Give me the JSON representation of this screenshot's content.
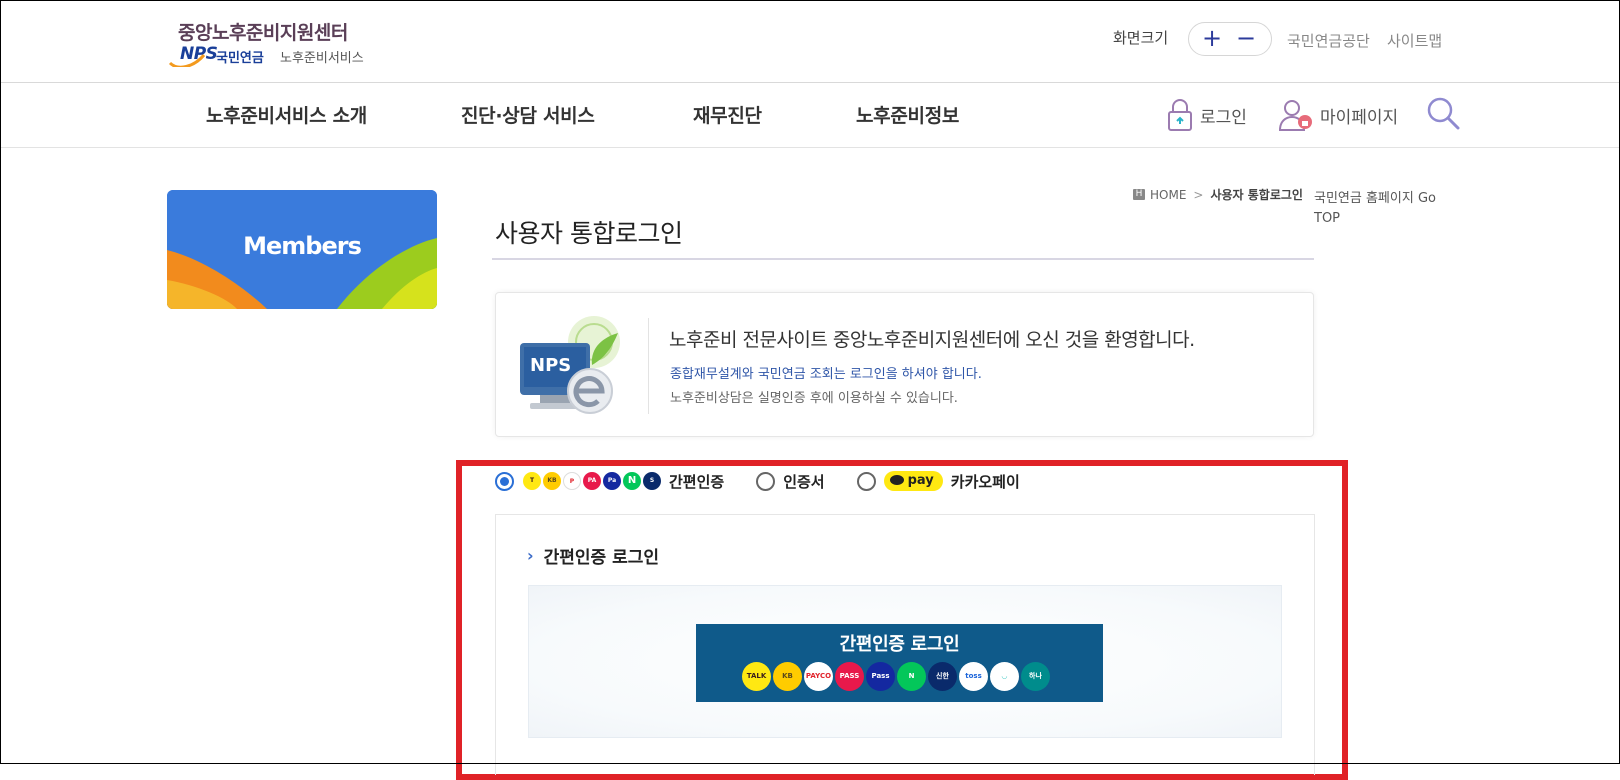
{
  "header": {
    "logo_main": "중앙노후준비지원센터",
    "logo_nps": "NPS",
    "logo_sub1": "국민연금",
    "logo_sub2": "노후준비서비스",
    "fontsize_label": "화면크기",
    "fontsize_plus": "+",
    "fontsize_minus": "−",
    "link_nps": "국민연금공단",
    "link_sitemap": "사이트맵"
  },
  "nav": {
    "items": [
      "노후준비서비스 소개",
      "진단·상담 서비스",
      "재무진단",
      "노후준비정보"
    ],
    "login": "로그인",
    "mypage": "마이페이지"
  },
  "sidebar": {
    "banner_label": "Members"
  },
  "breadcrumb": {
    "home_icon": "H",
    "home": "HOME",
    "sep": ">",
    "current": "사용자 통합로그인"
  },
  "side_links": {
    "nps_home": "국민연금 홈페이지 Go",
    "top": "TOP"
  },
  "page": {
    "title": "사용자 통합로그인"
  },
  "welcome": {
    "badge": "NPS",
    "heading": "노후준비 전문사이트 중앙노후준비지원센터에 오신 것을 환영합니다.",
    "line1": "종합재무설계와 국민연금 조회는 로그인을 하셔야 합니다.",
    "line2": "노후준비상담은 실명인증 후에 이용하실 수 있습니다."
  },
  "login_options": {
    "simple_auth": "간편인증",
    "certificate": "인증서",
    "kakaopay": "카카오페이",
    "pay_badge": "pay",
    "mini_icons": [
      "kakao-icon",
      "kb-icon",
      "payco-icon",
      "pass-icon",
      "samsung-pass-icon",
      "naver-icon",
      "shinhan-icon"
    ],
    "selected": "간편인증"
  },
  "panel": {
    "heading": "간편인증 로그인",
    "button_label": "간편인증 로그인",
    "providers": [
      {
        "name": "kakaotalk-icon",
        "label": "TALK",
        "color": "#ffe812",
        "text": "#3a1d1d"
      },
      {
        "name": "kb-icon",
        "label": "KB",
        "color": "#ffcc00",
        "text": "#5b4a1a"
      },
      {
        "name": "payco-icon",
        "label": "PAYCO",
        "color": "#ffffff",
        "text": "#e1242c"
      },
      {
        "name": "pass-icon",
        "label": "PASS",
        "color": "#e8194b",
        "text": "#ffffff"
      },
      {
        "name": "samsung-pass-icon",
        "label": "Pass",
        "color": "#1428a0",
        "text": "#ffffff"
      },
      {
        "name": "naver-icon",
        "label": "N",
        "color": "#03c75a",
        "text": "#ffffff"
      },
      {
        "name": "shinhan-icon",
        "label": "신한",
        "color": "#0a2a6b",
        "text": "#ffffff"
      },
      {
        "name": "toss-icon",
        "label": "toss",
        "color": "#ffffff",
        "text": "#1b64da"
      },
      {
        "name": "banksalad-icon",
        "label": "◡",
        "color": "#ffffff",
        "text": "#2ac1bc"
      },
      {
        "name": "hana-icon",
        "label": "하나",
        "color": "#008c8c",
        "text": "#ffffff"
      }
    ]
  },
  "colors": {
    "brand_purple": "#5a3f57",
    "nps_blue": "#1a3f99",
    "button_bg": "#0f5a8a",
    "highlight": "#e02227",
    "radio_on": "#2a6fd6"
  }
}
